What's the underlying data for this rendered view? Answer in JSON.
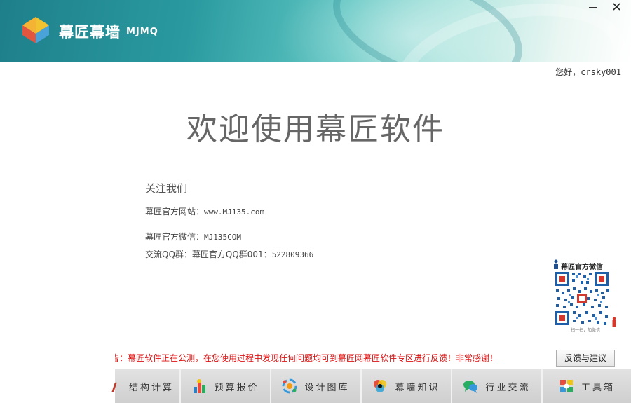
{
  "app": {
    "title": "幕匠幕墙",
    "abbr": "MJMQ",
    "colors": {
      "header_dark": "#1e7f8a",
      "header_light": "#a9e3dc",
      "notice_red": "#dd1111"
    }
  },
  "window_controls": {
    "minimize_icon": "minimize-icon",
    "close_icon": "close-icon"
  },
  "user": {
    "greeting": "您好，crsky001"
  },
  "main": {
    "welcome": "欢迎使用幕匠软件",
    "follow_title": "关注我们",
    "site_label": "幕匠官方网站：",
    "site_value": "www.MJ135.com",
    "wechat_label": "幕匠官方微信：",
    "wechat_value": "MJ135COM",
    "qq_label": "交流QQ群：幕匠官方QQ群001：",
    "qq_value": "522809366"
  },
  "qr": {
    "title": "幕匠官方微信",
    "caption": "扫一扫，加微信"
  },
  "notice": "告：幕匠软件正在公测，在您使用过程中发现任何问题均可到幕匠网幕匠软件专区进行反馈！非常感谢！",
  "feedback_button": "反馈与建议",
  "tabs": [
    {
      "label": "结构计算",
      "icon": "structure-calc-icon"
    },
    {
      "label": "预算报价",
      "icon": "budget-quote-icon"
    },
    {
      "label": "设计图库",
      "icon": "design-library-icon"
    },
    {
      "label": "幕墙知识",
      "icon": "curtain-wall-knowledge-icon"
    },
    {
      "label": "行业交流",
      "icon": "industry-chat-icon"
    },
    {
      "label": "工具箱",
      "icon": "toolbox-icon"
    }
  ]
}
